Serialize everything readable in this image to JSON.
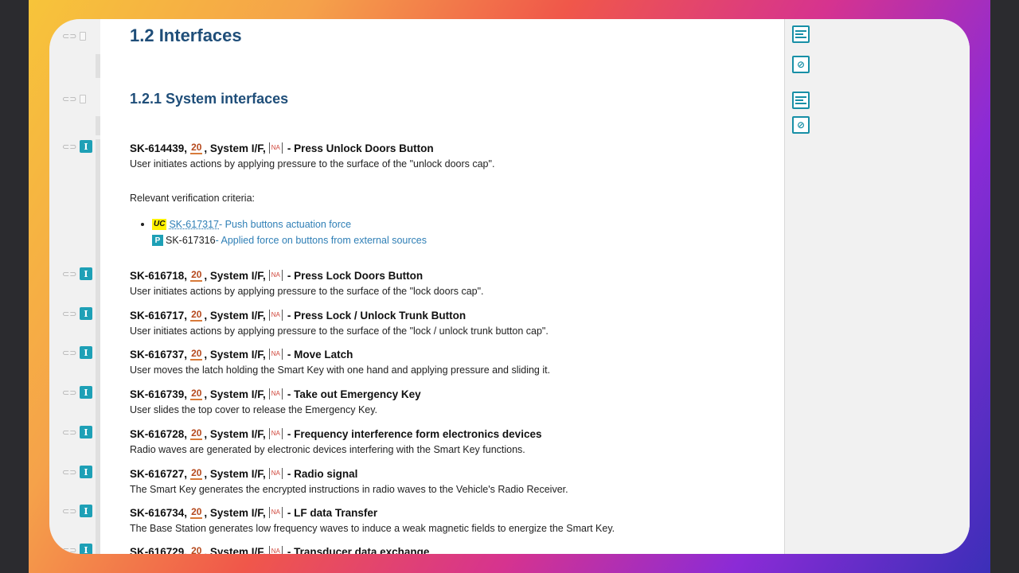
{
  "colors": {
    "heading": "#1f4e79",
    "badge": "#1ea0b6",
    "link": "#2f7fb6",
    "level": "#b5491d",
    "na": "#d0453a"
  },
  "document": {
    "section_title": "1.2 Interfaces",
    "subsection_title": "1.2.1 System interfaces"
  },
  "gutter": {
    "link_icon": "link-icon",
    "bookmark_icon": "bookmark-icon",
    "type_badge_label": "I"
  },
  "badges": {
    "level": "20",
    "na": "NA"
  },
  "requirements": [
    {
      "id": "SK-614439,",
      "type": ", System I/F,",
      "title": "- Press Unlock Doors Button",
      "description": "User initiates actions by applying pressure to the surface of the \"unlock doors cap\"."
    },
    {
      "id": "SK-616718,",
      "type": ", System I/F,",
      "title": "- Press Lock Doors Button",
      "description": "User initiates actions by applying pressure to the surface of the \"lock doors cap\"."
    },
    {
      "id": "SK-616717,",
      "type": ", System I/F,",
      "title": "- Press Lock / Unlock Trunk Button",
      "description": "User initiates actions by applying pressure to the surface of the \"lock / unlock trunk button cap\"."
    },
    {
      "id": "SK-616737,",
      "type": ", System I/F,",
      "title": "- Move Latch",
      "description": "User moves the latch holding the Smart Key with one hand and applying pressure and sliding it."
    },
    {
      "id": "SK-616739,",
      "type": ", System I/F,",
      "title": "- Take out Emergency Key",
      "description": "User slides the top cover to release the Emergency Key."
    },
    {
      "id": "SK-616728,",
      "type": ", System I/F,",
      "title": "- Frequency interference form electronics devices",
      "description": "Radio waves are generated by electronic devices interfering with the Smart Key functions."
    },
    {
      "id": "SK-616727,",
      "type": ", System I/F,",
      "title": "- Radio signal",
      "description": "The Smart Key generates the encrypted instructions in radio waves to the Vehicle's Radio Receiver."
    },
    {
      "id": "SK-616734,",
      "type": ", System I/F,",
      "title": "- LF data Transfer",
      "description": "The Base Station generates low frequency waves to induce a weak magnetic fields to energize the Smart Key."
    },
    {
      "id": "SK-616729,",
      "type": ", System I/F,",
      "title": "- Transducer data exchange",
      "description": ""
    }
  ],
  "verification": {
    "label": "Relevant verification criteria:",
    "items": [
      {
        "badge": "UC",
        "id": "SK-617317",
        "title": " - Push buttons actuation force"
      },
      {
        "badge": "P",
        "id": "SK-617316",
        "title": " - Applied force on buttons from external sources"
      }
    ]
  },
  "right_panel": {
    "icons": [
      "list-details-icon",
      "hide-eye-icon",
      "list-details-icon",
      "hide-eye-icon"
    ]
  }
}
